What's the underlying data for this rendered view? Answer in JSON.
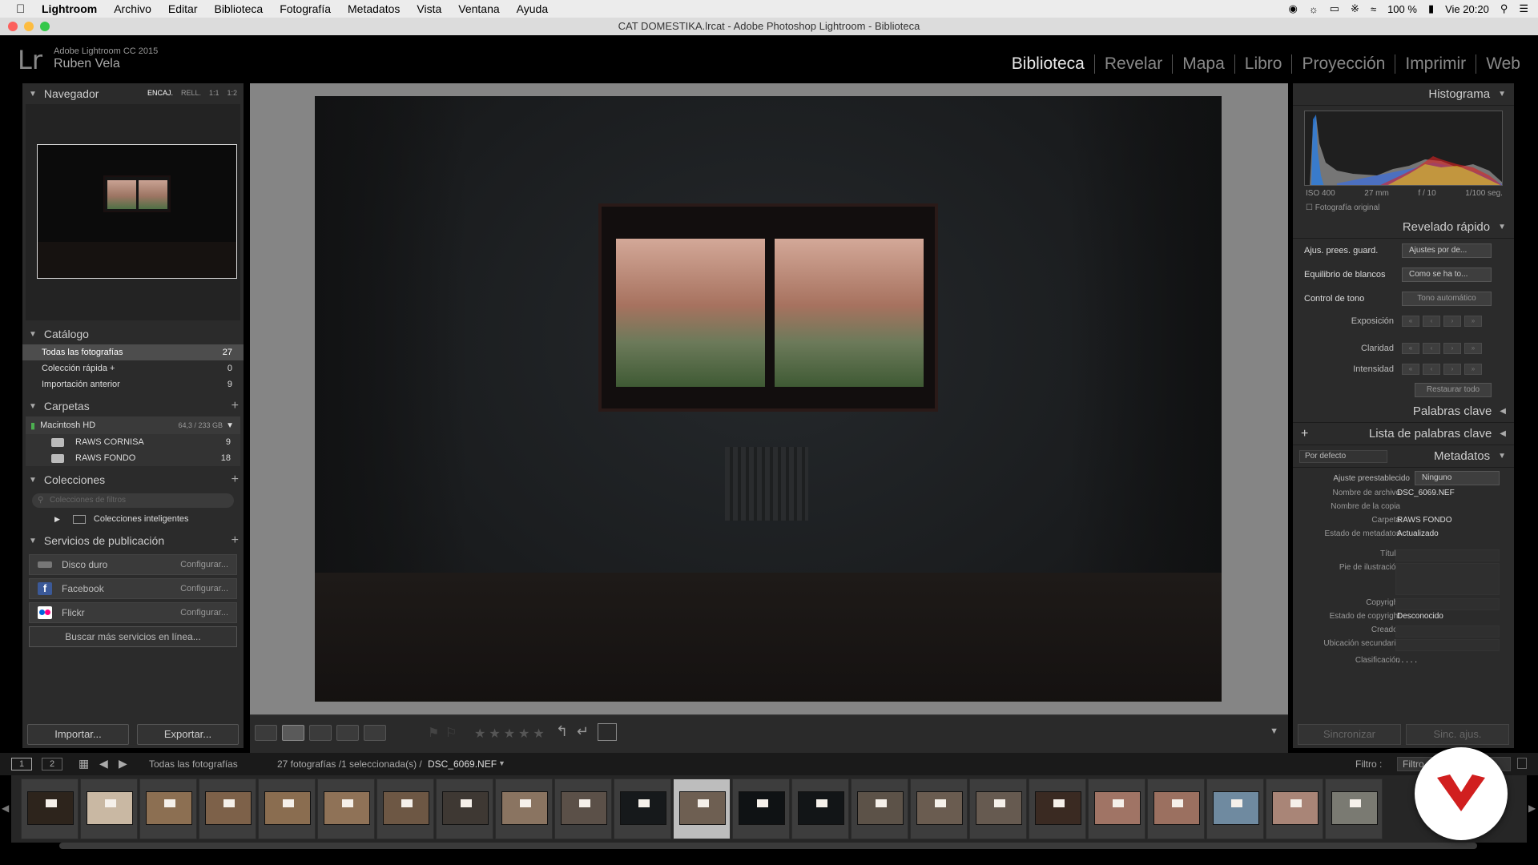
{
  "menubar": {
    "app": "Lightroom",
    "items": [
      "Archivo",
      "Editar",
      "Biblioteca",
      "Fotografía",
      "Metadatos",
      "Vista",
      "Ventana",
      "Ayuda"
    ],
    "battery": "100 %",
    "clock": "Vie 20:20"
  },
  "window": {
    "title": "CAT DOMESTIKA.lrcat - Adobe Photoshop Lightroom - Biblioteca"
  },
  "identity": {
    "product": "Adobe Lightroom CC 2015",
    "user": "Ruben Vela",
    "logo": "Lr"
  },
  "modules": [
    "Biblioteca",
    "Revelar",
    "Mapa",
    "Libro",
    "Proyección",
    "Imprimir",
    "Web"
  ],
  "navigator": {
    "title": "Navegador",
    "options": [
      "ENCAJ.",
      "RELL.",
      "1:1",
      "1:2"
    ]
  },
  "catalog": {
    "title": "Catálogo",
    "items": [
      {
        "label": "Todas las fotografías",
        "count": "27"
      },
      {
        "label": "Colección rápida +",
        "count": "0"
      },
      {
        "label": "Importación anterior",
        "count": "9"
      }
    ]
  },
  "folders": {
    "title": "Carpetas",
    "disk": {
      "name": "Macintosh HD",
      "size": "64,3 / 233 GB"
    },
    "items": [
      {
        "label": "RAWS CORNISA",
        "count": "9"
      },
      {
        "label": "RAWS FONDO",
        "count": "18"
      }
    ]
  },
  "collections": {
    "title": "Colecciones",
    "filter_placeholder": "Colecciones de filtros",
    "smart": "Colecciones inteligentes"
  },
  "publish": {
    "title": "Servicios de publicación",
    "services": [
      {
        "name": "Disco duro",
        "action": "Configurar..."
      },
      {
        "name": "Facebook",
        "action": "Configurar..."
      },
      {
        "name": "Flickr",
        "action": "Configurar..."
      }
    ],
    "more": "Buscar más servicios en línea..."
  },
  "left_buttons": {
    "import": "Importar...",
    "export": "Exportar..."
  },
  "histogram": {
    "title": "Histograma",
    "iso": "ISO 400",
    "focal": "27 mm",
    "aperture": "f / 10",
    "shutter": "1/100 seg.",
    "original": "Fotografía original"
  },
  "quick_develop": {
    "title": "Revelado rápido",
    "preset_label": "Ajus. prees. guard.",
    "preset_value": "Ajustes por de...",
    "wb_label": "Equilibrio de blancos",
    "wb_value": "Como se ha to...",
    "tone_label": "Control de tono",
    "tone_button": "Tono automático",
    "adjustments": [
      "Exposición",
      "Claridad",
      "Intensidad"
    ],
    "reset": "Restaurar todo"
  },
  "keywords": {
    "title": "Palabras clave",
    "list_title": "Lista de palabras clave"
  },
  "metadata": {
    "title": "Metadatos",
    "view": "Por defecto",
    "preset_label": "Ajuste preestablecido",
    "preset_value": "Ninguno",
    "fields": [
      {
        "k": "Nombre de archivo",
        "v": "DSC_6069.NEF"
      },
      {
        "k": "Nombre de la copia",
        "v": ""
      },
      {
        "k": "Carpeta",
        "v": "RAWS FONDO"
      },
      {
        "k": "Estado de metadatos",
        "v": "Actualizado"
      }
    ],
    "labels": [
      "Título",
      "Pie de ilustración",
      "Copyright",
      "Estado de copyright",
      "Creador",
      "Ubicación secundaria",
      "Clasificación"
    ],
    "copyright_status": "Desconocido",
    "rating": ". . . . ."
  },
  "sync": {
    "left": "Sincronizar",
    "right": "Sinc. ajus."
  },
  "filmstrip_header": {
    "views": [
      "1",
      "2"
    ],
    "source": "Todas las fotografías",
    "count": "27 fotografías /1 seleccionada(s) /",
    "file": "DSC_6069.NEF",
    "filter_label": "Filtro :",
    "filter_value": "Filtro"
  },
  "filmstrip": {
    "count": 23,
    "selected": 12,
    "tones": [
      "#2d241c",
      "#c9b8a3",
      "#8c6f52",
      "#7d6149",
      "#8a6d50",
      "#8f7257",
      "#6d5744",
      "#3e3833",
      "#8a7461",
      "#5b5048",
      "#16191b",
      "#6e5f52",
      "#0f1214",
      "#121517",
      "#5c5248",
      "#6a5c50",
      "#665a50",
      "#3a2a22",
      "#a07465",
      "#9b7060",
      "#6f8aa0",
      "#a98577",
      "#7a7a72"
    ]
  },
  "colors": {
    "accent": "#d11f1f",
    "panel": "#2b2b2b",
    "center": "#858585"
  }
}
